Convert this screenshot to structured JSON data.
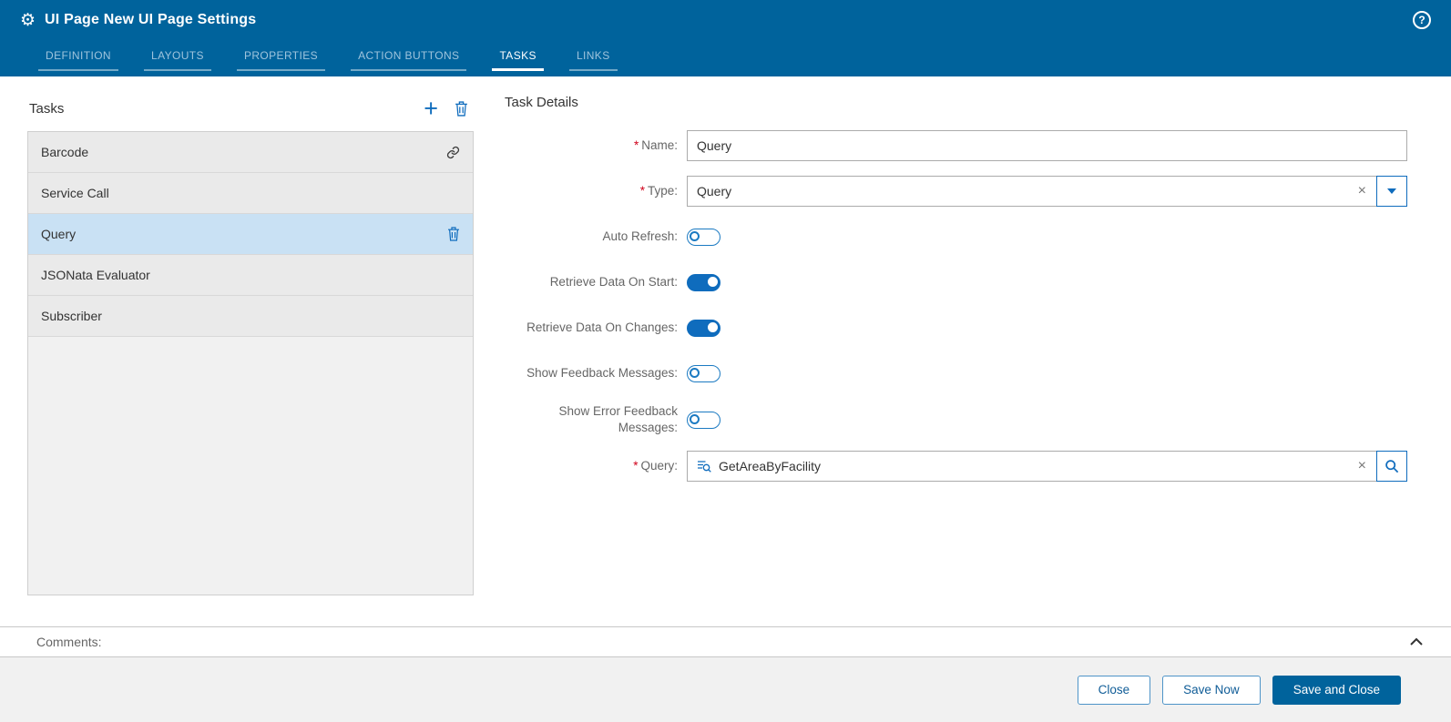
{
  "colors": {
    "header_bg": "#00639C",
    "accent_blue": "#0F6CBD",
    "toggle_on": "#0F6CBD",
    "selected_row_bg": "#C9E1F4",
    "required_red": "#D0021B",
    "footer_bg": "#F1F1F1",
    "primary_button_bg": "#00639C"
  },
  "icons": {
    "gear": "⚙",
    "help": "?",
    "add": "+",
    "clear": "×"
  },
  "header": {
    "title": "UI Page New UI Page Settings",
    "tabs": [
      {
        "label": "DEFINITION",
        "active": false
      },
      {
        "label": "LAYOUTS",
        "active": false
      },
      {
        "label": "PROPERTIES",
        "active": false
      },
      {
        "label": "ACTION BUTTONS",
        "active": false
      },
      {
        "label": "TASKS",
        "active": true
      },
      {
        "label": "LINKS",
        "active": false
      }
    ]
  },
  "tasks_panel": {
    "title": "Tasks",
    "items": [
      {
        "label": "Barcode",
        "selected": false,
        "trailing_icon": "link-icon"
      },
      {
        "label": "Service Call",
        "selected": false,
        "trailing_icon": ""
      },
      {
        "label": "Query",
        "selected": true,
        "trailing_icon": "trash-icon"
      },
      {
        "label": "JSONata Evaluator",
        "selected": false,
        "trailing_icon": ""
      },
      {
        "label": "Subscriber",
        "selected": false,
        "trailing_icon": ""
      }
    ]
  },
  "details": {
    "title": "Task Details",
    "required_marker": "*",
    "fields": {
      "name": {
        "label": "Name:",
        "required": true,
        "value": "Query"
      },
      "type": {
        "label": "Type:",
        "required": true,
        "value": "Query"
      },
      "auto_refresh": {
        "label": "Auto Refresh:",
        "on": false
      },
      "retrieve_on_start": {
        "label": "Retrieve Data On Start:",
        "on": true
      },
      "retrieve_on_changes": {
        "label": "Retrieve Data On Changes:",
        "on": true
      },
      "show_feedback": {
        "label": "Show Feedback Messages:",
        "on": false
      },
      "show_error_feedback": {
        "label": "Show Error Feedback Messages:",
        "on": false
      },
      "query": {
        "label": "Query:",
        "required": true,
        "value": "GetAreaByFacility"
      }
    }
  },
  "comments": {
    "label": "Comments:"
  },
  "footer": {
    "close_label": "Close",
    "save_now_label": "Save Now",
    "save_and_close_label": "Save and Close"
  }
}
